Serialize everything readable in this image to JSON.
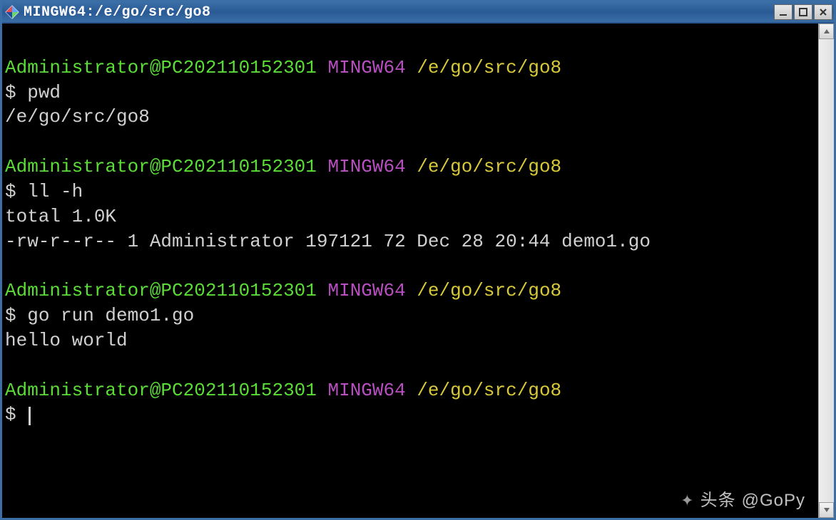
{
  "window": {
    "title": "MINGW64:/e/go/src/go8"
  },
  "prompt": {
    "user": "Administrator@PC202110152301",
    "env": "MINGW64",
    "cwd": "/e/go/src/go8",
    "symbol": "$"
  },
  "blocks": [
    {
      "cmd": "pwd",
      "output": [
        "/e/go/src/go8"
      ]
    },
    {
      "cmd": "ll -h",
      "output": [
        "total 1.0K",
        "-rw-r--r-- 1 Administrator 197121 72 Dec 28 20:44 demo1.go"
      ]
    },
    {
      "cmd": "go run demo1.go",
      "output": [
        "hello world"
      ]
    }
  ],
  "watermark": {
    "label": "头条",
    "handle": "@GoPy"
  }
}
